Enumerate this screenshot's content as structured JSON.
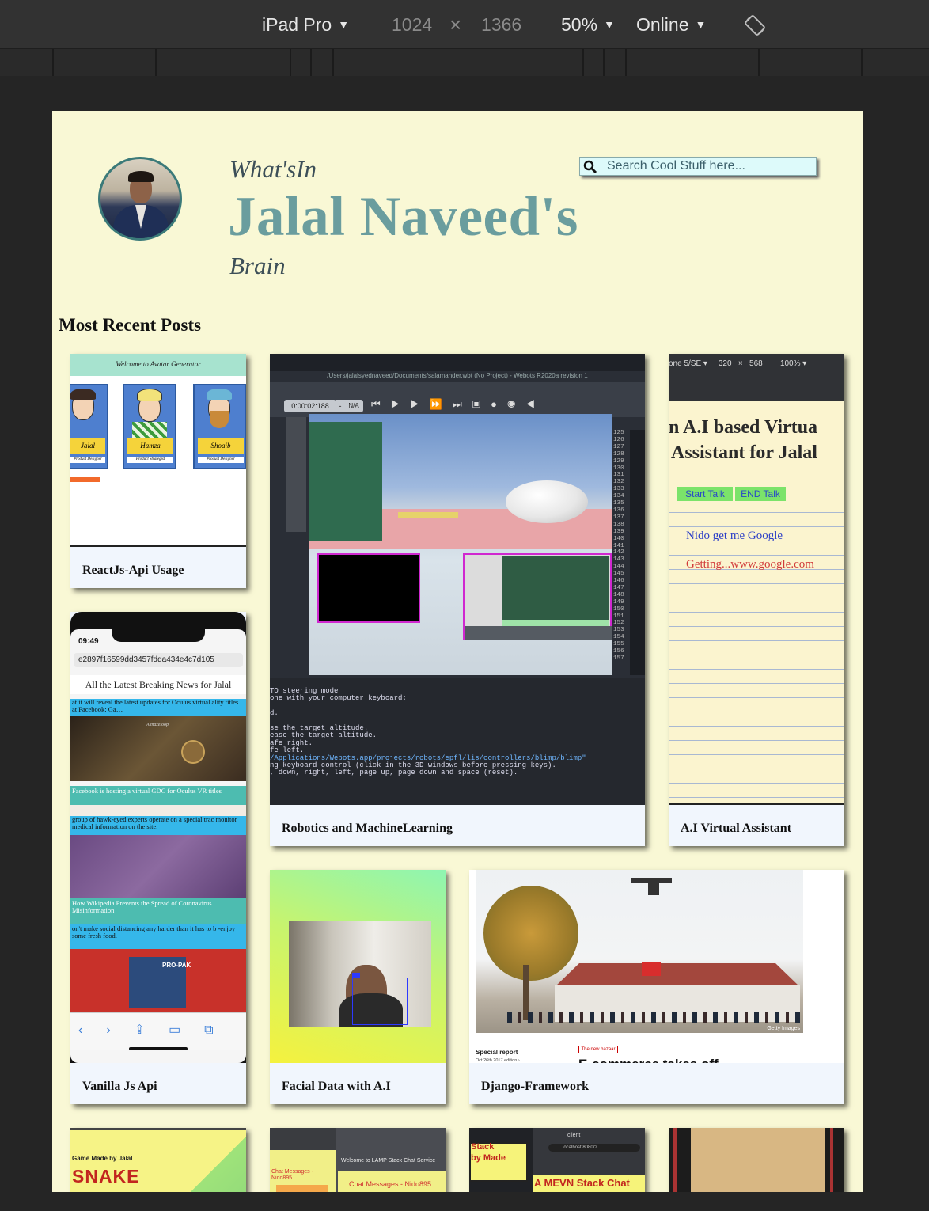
{
  "devtools": {
    "device": "iPad Pro",
    "width": "1024",
    "times": "×",
    "height": "1366",
    "zoom": "50%",
    "network": "Online",
    "rotate_icon": "rotate-icon"
  },
  "header": {
    "whats_in": "What'sIn",
    "name": "Jalal Naveed's",
    "brain": "Brain",
    "avatar_icon": "avatar"
  },
  "search": {
    "placeholder": "Search Cool Stuff here...",
    "icon": "search-icon"
  },
  "section_title": "Most Recent Posts",
  "posts": [
    {
      "title": "ReactJs-Api Usage",
      "thumb": {
        "heading": "Welcome to Avatar Generator",
        "names": [
          "Jalal",
          "Hamza",
          "Shoaib"
        ],
        "roles": [
          "Product Designer",
          "Product Strategist",
          "Product Designer"
        ]
      }
    },
    {
      "title": "Robotics and MachineLearning",
      "thumb": {
        "window_title": "/Users/jalalsyednaveed/Documents/salamander.wbt (No Project) - Webots R2020a revision 1",
        "timer": "0:00:02:188",
        "timer_sep": "-",
        "timer_na": "N/A",
        "line_numbers": [
          "125",
          "126",
          "127",
          "128",
          "129",
          "130",
          "131",
          "132",
          "133",
          "134",
          "135",
          "136",
          "137",
          "138",
          "139",
          "140",
          "141",
          "142",
          "143",
          "144",
          "145",
          "146",
          "147",
          "148",
          "149",
          "150",
          "151",
          "152",
          "153",
          "154",
          "155",
          "156",
          "157"
        ],
        "console": [
          "TO steering mode",
          "one with your computer keyboard:",
          "",
          "d.",
          "",
          "se the target altitude.",
          "ease the target altitude.",
          "afe right.",
          "fe left.",
          "/Applications/Webots.app/projects/robots/epfl/lis/controllers/blimp/blimp\"",
          "ng keyboard control (click in the 3D windows before pressing keys).",
          ", down, right, left, page up, page down and space (reset)."
        ]
      }
    },
    {
      "title": "A.I Virtual Assistant",
      "thumb": {
        "device_bar": "one 5/SE ▾     320   ×   568        100% ▾",
        "heading_1": "n A.I based Virtua",
        "heading_2": "Assistant for Jalal",
        "start": "Start Talk",
        "end": "END Talk",
        "line_1": "Nido get me Google",
        "line_2": "Getting...www.google.com"
      }
    },
    {
      "title": "Vanilla Js Api",
      "thumb": {
        "time": "09:49",
        "url": "e2897f16599dd3457fdda434e4c7d105",
        "heading": "All the Latest Breaking News for Jalal",
        "news": [
          "at it will reveal the latest updates for Oculus virtual ality titles at Facebook: Ga…",
          "Facebook is hosting a virtual GDC for Oculus VR titles",
          "group of hawk-eyed  experts operate on a special trac monitor medical information on the site.",
          "How Wikipedia Prevents the Spread of Coronavirus Misinformation",
          "on't make social distancing any harder than it has to b -enjoy some fresh food."
        ],
        "maze_caption": "A mazeloop",
        "ad_text": "PRO-PAK"
      }
    },
    {
      "title": "Facial Data with A.I",
      "thumb": {}
    },
    {
      "title": "Django-Framework",
      "thumb": {
        "special_report": "Special report",
        "date": "Oct 26th 2017 edition ›",
        "badge": "The new bazaar",
        "headline": "E-commerce takes off",
        "credit": "Getty Images"
      }
    },
    {
      "title": "",
      "thumb": {
        "caption": "Game Made by Jalal",
        "big": "SNAKE"
      }
    },
    {
      "title": "",
      "thumb": {
        "welcome": "Welcome to LAMP Stack Chat Service",
        "chat_1": "Chat Messages - Nido895",
        "chat_2": "Chat Messages - Nido895"
      }
    },
    {
      "title": "",
      "thumb": {
        "side_1": "Stack",
        "side_2": "by Made",
        "big": "A MEVN Stack Chat",
        "host": "localhost:8080/?",
        "tab": "client"
      }
    },
    {
      "title": "",
      "thumb": {}
    }
  ]
}
